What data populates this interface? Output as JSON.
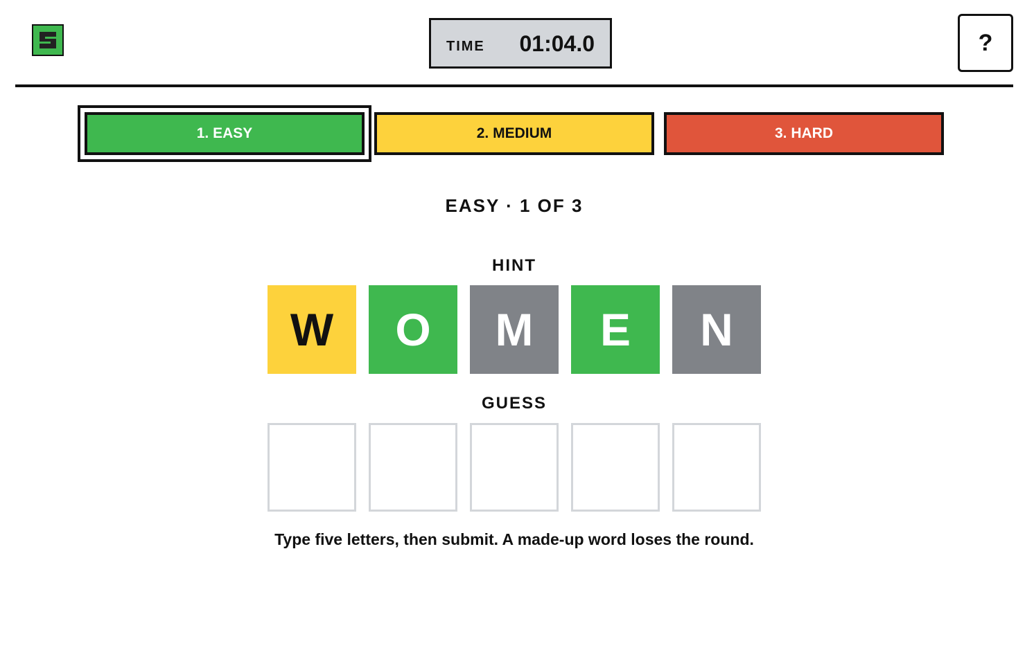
{
  "header": {
    "logo_icon": "s-logo-icon",
    "timer_label": "TIME",
    "timer_value": "01:04.0",
    "help_label": "?"
  },
  "tabs": [
    {
      "label": "1. EASY",
      "color": "#3fb84f",
      "selected": true
    },
    {
      "label": "2. MEDIUM",
      "color": "#fdd23c",
      "selected": false
    },
    {
      "label": "3. HARD",
      "color": "#e0553b",
      "selected": false
    }
  ],
  "round_label": "EASY · 1 OF 3",
  "hint": {
    "label": "HINT",
    "tiles": [
      {
        "letter": "W",
        "state": "present",
        "color": "#fdd23c",
        "text_color": "#111111"
      },
      {
        "letter": "O",
        "state": "correct",
        "color": "#3fb84f",
        "text_color": "#ffffff"
      },
      {
        "letter": "M",
        "state": "absent",
        "color": "#808388",
        "text_color": "#ffffff"
      },
      {
        "letter": "E",
        "state": "correct",
        "color": "#3fb84f",
        "text_color": "#ffffff"
      },
      {
        "letter": "N",
        "state": "absent",
        "color": "#808388",
        "text_color": "#ffffff"
      }
    ]
  },
  "guess": {
    "label": "GUESS",
    "letters": [
      "",
      "",
      "",
      "",
      ""
    ]
  },
  "instructions": "Type five letters, then submit. A made-up word loses the round."
}
